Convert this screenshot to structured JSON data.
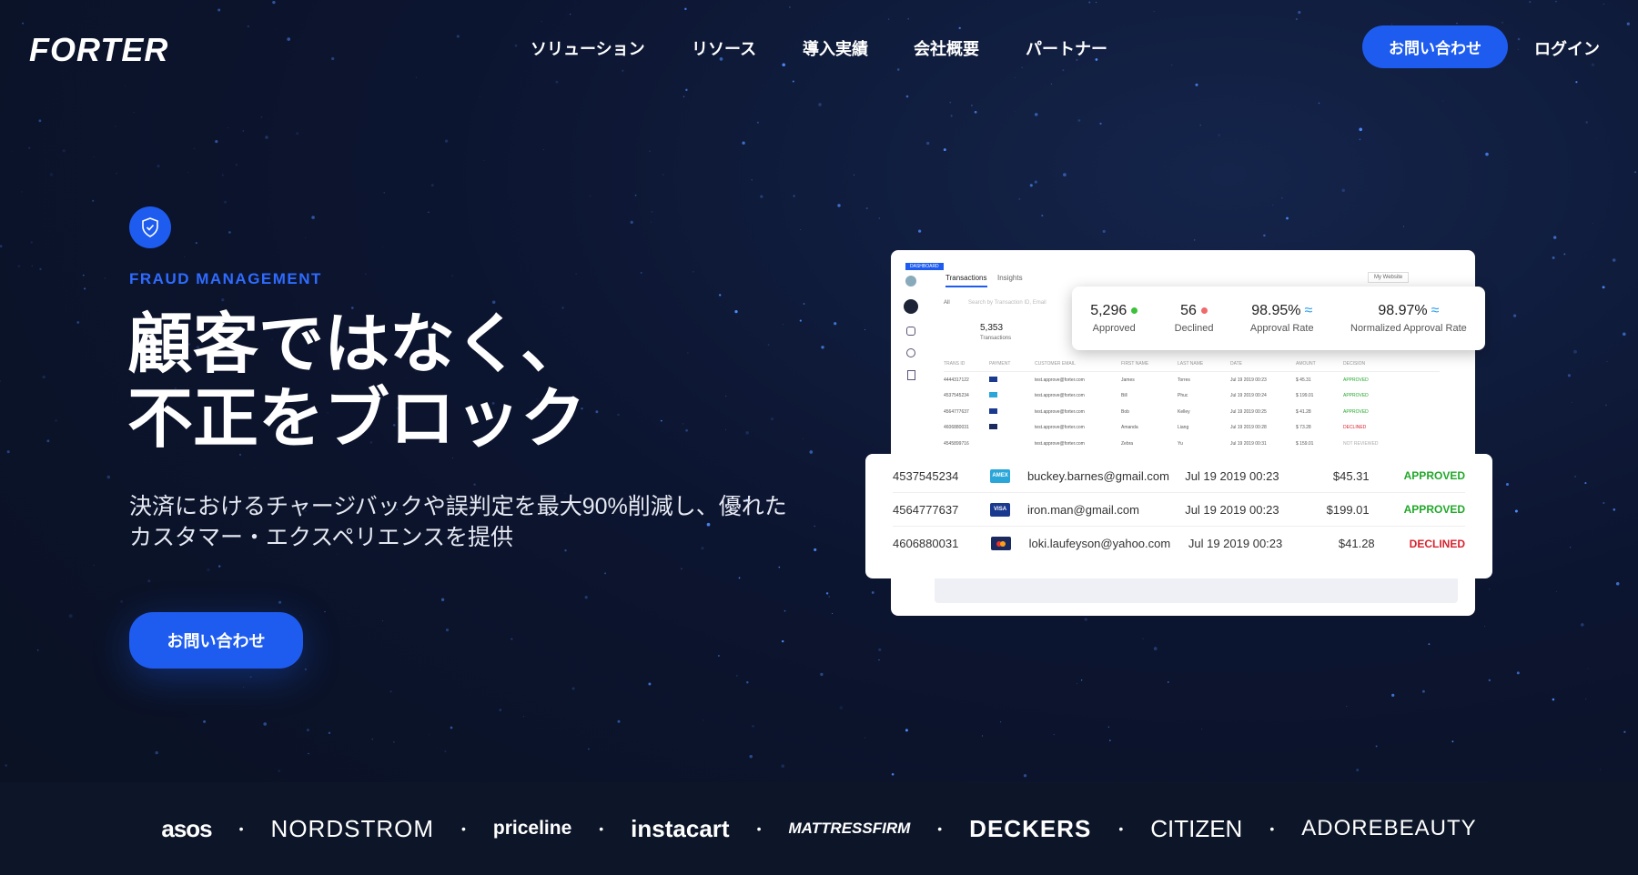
{
  "header": {
    "logo": "FORTER",
    "nav": [
      "ソリューション",
      "リソース",
      "導入実績",
      "会社概要",
      "パートナー"
    ],
    "contact_button": "お問い合わせ",
    "login": "ログイン"
  },
  "hero": {
    "eyebrow": "FRAUD MANAGEMENT",
    "title_line1": "顧客ではなく、",
    "title_line2": "不正をブロック",
    "subtitle": "決済におけるチャージバックや誤判定を最大90%削減し、優れたカスタマー・エクスペリエンスを提供",
    "cta": "お問い合わせ"
  },
  "dashboard": {
    "badge": "DASHBOARD",
    "tabs": [
      "Transactions",
      "Insights"
    ],
    "filter": "All",
    "search_placeholder": "Search by Transaction ID, Email",
    "site_select": "My Website",
    "transactions_count": "5,353",
    "transactions_label": "Transactions",
    "stats": [
      {
        "value": "5,296",
        "label": "Approved",
        "mark": "#3cc13b"
      },
      {
        "value": "56",
        "label": "Declined",
        "mark": "#f06a6a"
      },
      {
        "value": "98.95%",
        "label": "Approval Rate",
        "mark": "trend-icon"
      },
      {
        "value": "98.97%",
        "label": "Normalized Approval Rate",
        "mark": "trend-icon"
      }
    ],
    "columns": [
      "TRANS ID",
      "PAYMENT",
      "CUSTOMER EMAIL",
      "FIRST NAME",
      "LAST NAME",
      "DATE",
      "AMOUNT",
      "DECISION"
    ],
    "rows": [
      [
        "4444317122",
        "visa",
        "test.approve@forter.com",
        "James",
        "Torres",
        "Jul 19 2019  00:23",
        "$ 45.31",
        "APPROVED"
      ],
      [
        "4537545234",
        "amex",
        "test.approve@forter.com",
        "Bill",
        "Phuc",
        "Jul 19 2019  00:24",
        "$ 199.01",
        "APPROVED"
      ],
      [
        "4564777637",
        "visa",
        "test.approve@forter.com",
        "Bob",
        "Kelley",
        "Jul 19 2019  00:25",
        "$ 41.28",
        "APPROVED"
      ],
      [
        "4606880031",
        "mastercard",
        "test.approve@forter.com",
        "Amanda",
        "Liang",
        "Jul 19 2019  00:28",
        "$ 73.28",
        "DECLINED"
      ],
      [
        "4545899716",
        "paypal",
        "test.approve@forter.com",
        "Zebra",
        "Yu",
        "Jul 19 2019  00:31",
        "$ 159.01",
        "NOT REVIEWED"
      ]
    ]
  },
  "overlay_rows": [
    {
      "id": "4537545234",
      "pay": "AMEX",
      "email": "buckey.barnes@gmail.com",
      "date": "Jul 19 2019  00:23",
      "amount": "$45.31",
      "decision": "APPROVED"
    },
    {
      "id": "4564777637",
      "pay": "VISA",
      "email": "iron.man@gmail.com",
      "date": "Jul 19 2019  00:23",
      "amount": "$199.01",
      "decision": "APPROVED"
    },
    {
      "id": "4606880031",
      "pay": "MC",
      "email": "loki.laufeyson@yahoo.com",
      "date": "Jul 19 2019  00:23",
      "amount": "$41.28",
      "decision": "DECLINED"
    }
  ],
  "colors": {
    "accent": "#1e5cf0",
    "approved": "#22a82a",
    "declined": "#d9232d"
  },
  "brands": [
    "asos",
    "NORDSTROM",
    "priceline",
    "instacart",
    "MATTRESSFIRM",
    "DECKERS",
    "CITIZEN",
    "ADOREBEAUTY"
  ]
}
